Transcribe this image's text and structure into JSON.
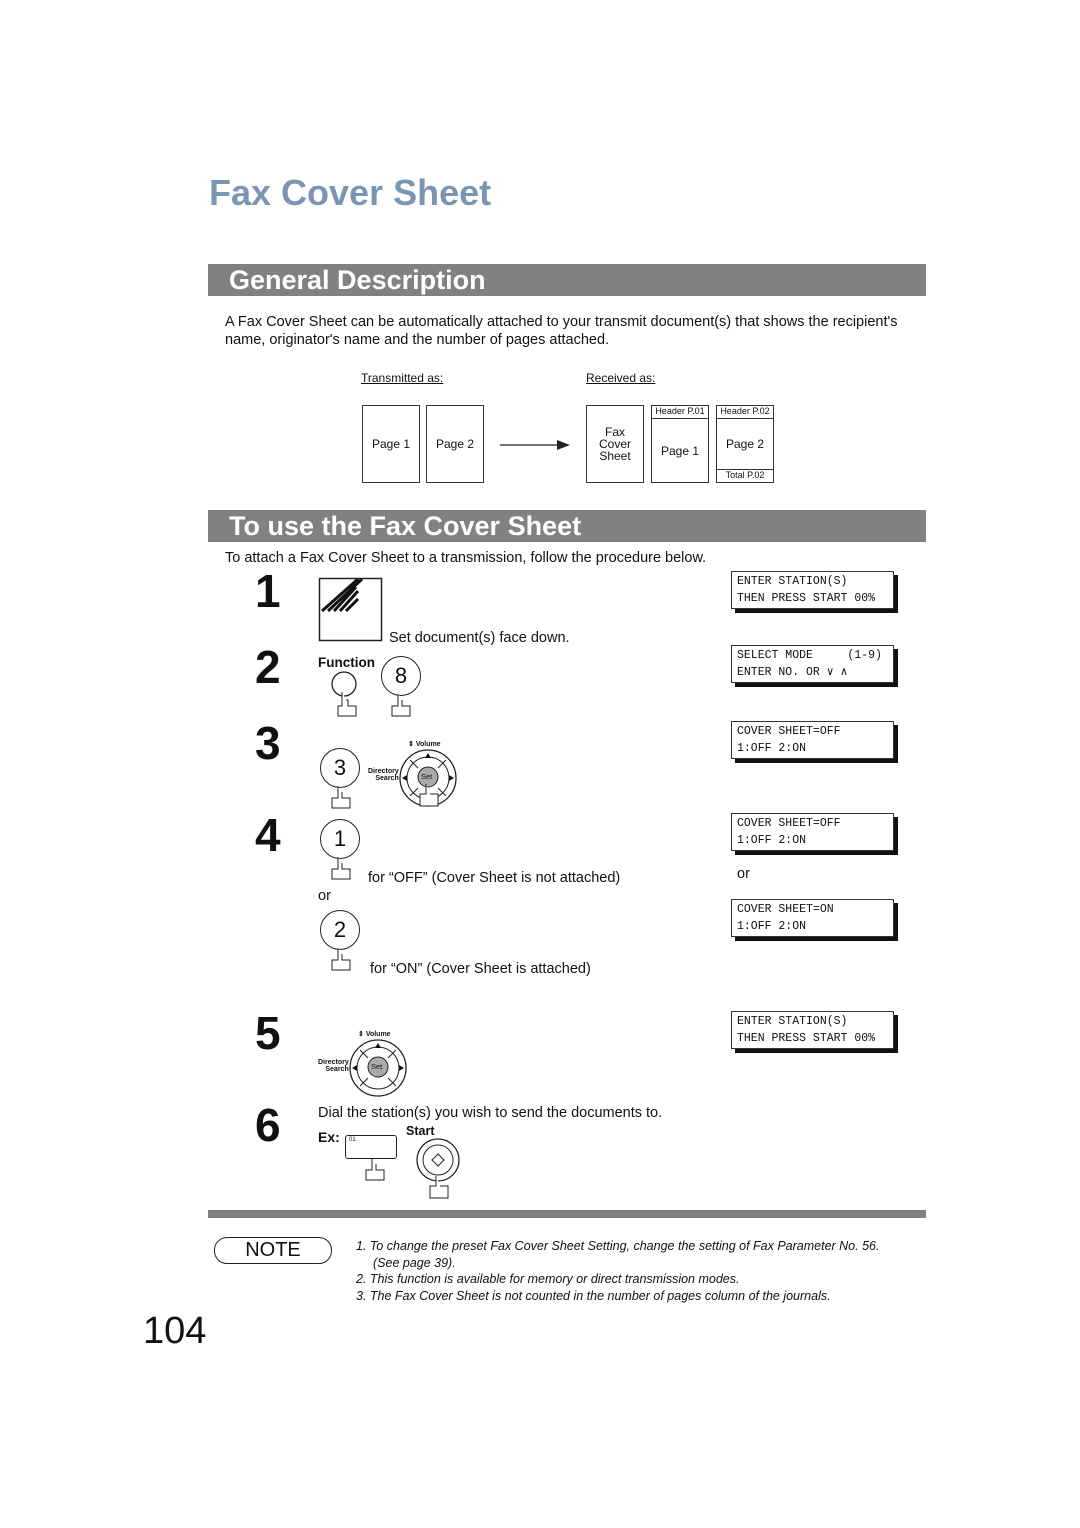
{
  "title": "Fax Cover Sheet",
  "section1": {
    "heading": "General Description",
    "text1": "A Fax Cover Sheet  can be automatically attached to your transmit document(s) that shows the recipient's",
    "text2": "name, originator's name and the number of pages attached."
  },
  "diagram": {
    "transmitted_label": "Transmitted as:",
    "received_label": "Received as:",
    "tx_pages": [
      "Page 1",
      "Page 2"
    ],
    "cover": [
      "Fax",
      "Cover",
      "Sheet"
    ],
    "rx_pages": [
      "Page 1",
      "Page 2"
    ],
    "headers": [
      "Header P.01",
      "Header P.02"
    ],
    "total": "Total P.02"
  },
  "section2": {
    "heading": "To use the Fax Cover Sheet",
    "intro": "To attach a Fax Cover Sheet to a transmission, follow the procedure below."
  },
  "steps": {
    "s1": {
      "num": "1",
      "text": "Set document(s) face down.",
      "lcd1": "ENTER STATION(S)",
      "lcd2": "THEN PRESS START 00%"
    },
    "s2": {
      "num": "2",
      "function_label": "Function",
      "key": "8",
      "lcd1": "SELECT MODE     (1-9)",
      "lcd2": "ENTER NO. OR ∨ ∧"
    },
    "s3": {
      "num": "3",
      "key": "3",
      "volume": "Volume",
      "directory": "Directory",
      "search": "Search",
      "set": "Set",
      "lcd1": "COVER SHEET=OFF",
      "lcd2": "1:OFF 2:ON"
    },
    "s4": {
      "num": "4",
      "key1": "1",
      "text1": "for “OFF” (Cover Sheet is not attached)",
      "or": "or",
      "key2": "2",
      "text2": "for “ON” (Cover Sheet is attached)",
      "lcdA1": "COVER SHEET=OFF",
      "lcdA2": "1:OFF 2:ON",
      "lcd_or": "or",
      "lcdB1": "COVER SHEET=ON",
      "lcdB2": "1:OFF 2:ON"
    },
    "s5": {
      "num": "5",
      "volume": "Volume",
      "directory": "Directory",
      "search": "Search",
      "set": "Set",
      "lcd1": "ENTER STATION(S)",
      "lcd2": "THEN PRESS START 00%"
    },
    "s6": {
      "num": "6",
      "text": "Dial the station(s) you wish to send the documents to.",
      "ex": "Ex:",
      "onetouch": "01",
      "start": "Start"
    }
  },
  "note": {
    "label": "NOTE",
    "items": [
      "1.  To change the preset Fax Cover Sheet Setting, change the setting of Fax Parameter No. 56.",
      "     (See page 39).",
      "2.  This function is available for memory or direct transmission modes.",
      "3.  The Fax Cover Sheet is not counted in the number of pages column of the journals."
    ]
  },
  "page_number": "104"
}
